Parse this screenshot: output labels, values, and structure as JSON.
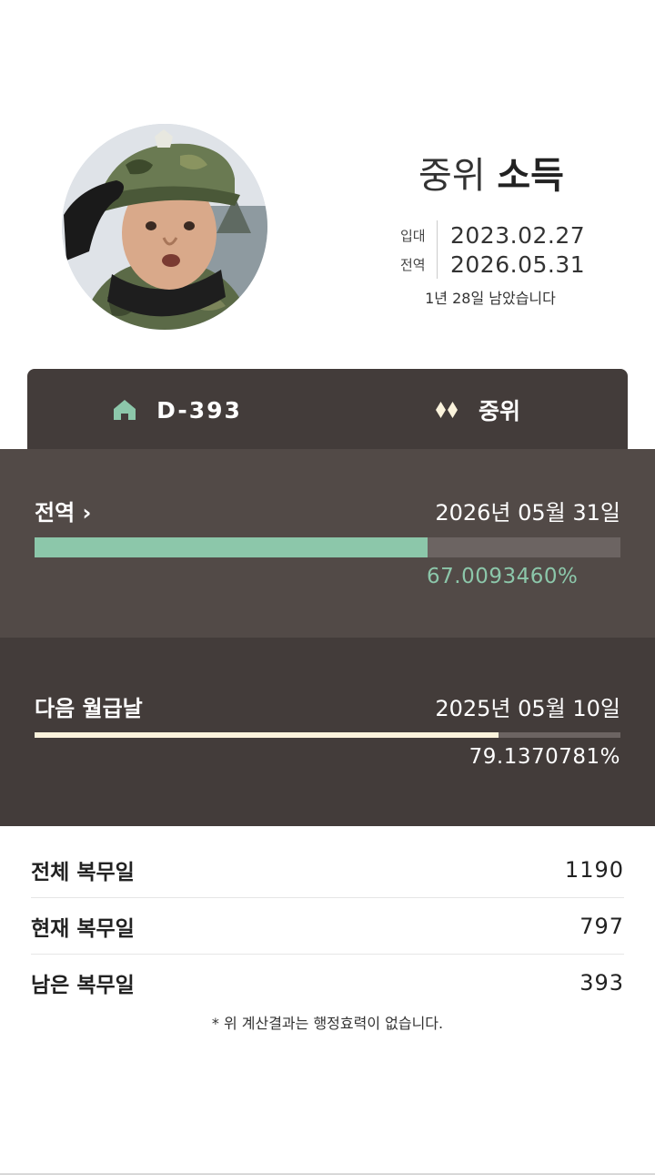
{
  "profile": {
    "rank": "중위",
    "name": "소득",
    "enlist_label": "입대",
    "enlist_date": "2023.02.27",
    "discharge_label": "전역",
    "discharge_date": "2026.05.31",
    "remaining_text": "1년 28일 남았습니다"
  },
  "tabs": [
    {
      "label": "D-393",
      "icon": "home-icon"
    },
    {
      "label": "중위",
      "icon": "rank-diamonds-icon"
    }
  ],
  "discharge_progress": {
    "title": "전역",
    "chevron": "›",
    "date": "2026년 05월 31일",
    "percent_text": "67.0093460%",
    "fraction": 0.67009346
  },
  "pay_progress": {
    "title": "다음 월급날",
    "date": "2025년 05월 10일",
    "percent_text": "79.1370781%",
    "fraction": 0.791370781
  },
  "stats": [
    {
      "label": "전체 복무일",
      "value": "1190"
    },
    {
      "label": "현재 복무일",
      "value": "797"
    },
    {
      "label": "남은 복무일",
      "value": "393"
    }
  ],
  "footnote": "* 위 계산결과는 행정효력이 없습니다.",
  "colors": {
    "accent_green": "#8cc7aa",
    "pay_bar": "#fbf3dc",
    "panel_dark": "#433c3a",
    "panel_mid": "#524a47",
    "track": "#6c6462"
  }
}
